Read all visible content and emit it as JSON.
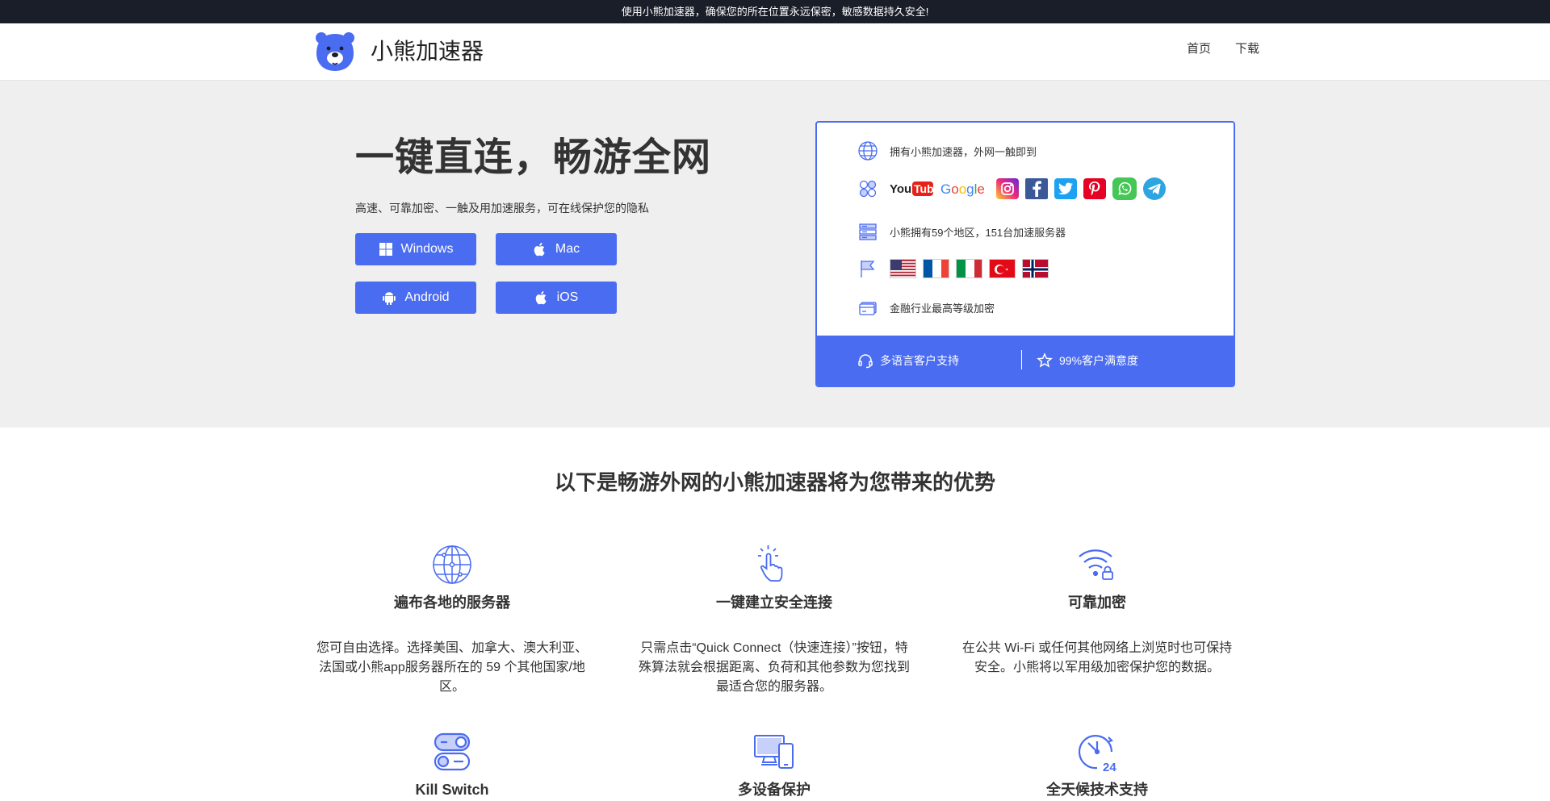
{
  "topbar": {
    "message": "使用小熊加速器，确保您的所在位置永远保密，敏感数据持久安全!"
  },
  "header": {
    "brand": "小熊加速器",
    "nav": [
      {
        "label": "首页"
      },
      {
        "label": "下载"
      }
    ]
  },
  "hero": {
    "title": "一键直连，畅游全网",
    "subtitle": "高速、可靠加密、一触及用加速服务，可在线保护您的隐私",
    "buttons": {
      "windows": "Windows",
      "mac": "Mac",
      "android": "Android",
      "ios": "iOS"
    }
  },
  "card": {
    "row1": "拥有小熊加速器，外网一触即到",
    "apps": [
      "YouTube",
      "Google",
      "Instagram",
      "Facebook",
      "Twitter",
      "Pinterest",
      "WhatsApp",
      "Telegram"
    ],
    "row3": "小熊拥有59个地区，151台加速服务器",
    "flags": [
      "us",
      "fr",
      "it",
      "tr",
      "no"
    ],
    "row5": "金融行业最高等级加密",
    "footer": {
      "support": "多语言客户支持",
      "satisfaction": "99%客户满意度"
    }
  },
  "features": {
    "title": "以下是畅游外网的小熊加速器将为您带来的优势",
    "items": [
      {
        "name": "遍布各地的服务器",
        "desc": "您可自由选择。选择美国、加拿大、澳大利亚、法国或小熊app服务器所在的 59 个其他国家/地区。",
        "icon": "globe-icon"
      },
      {
        "name": "一键建立安全连接",
        "desc": "只需点击“Quick Connect（快速连接）”按钮，特殊算法就会根据距离、负荷和其他参数为您找到最适合您的服务器。",
        "icon": "tap-icon"
      },
      {
        "name": "可靠加密",
        "desc": "在公共 Wi-Fi 或任何其他网络上浏览时也可保持安全。小熊将以军用级加密保护您的数据。",
        "icon": "wifi-lock-icon"
      },
      {
        "name": "Kill Switch",
        "desc": "",
        "icon": "toggle-icon"
      },
      {
        "name": "多设备保护",
        "desc": "",
        "icon": "devices-icon"
      },
      {
        "name": "全天候技术支持",
        "desc": "",
        "icon": "support-24-icon"
      }
    ]
  },
  "colors": {
    "accent": "#4a6cf0",
    "topbar": "#1a1e29",
    "hero_bg": "#efefef"
  }
}
